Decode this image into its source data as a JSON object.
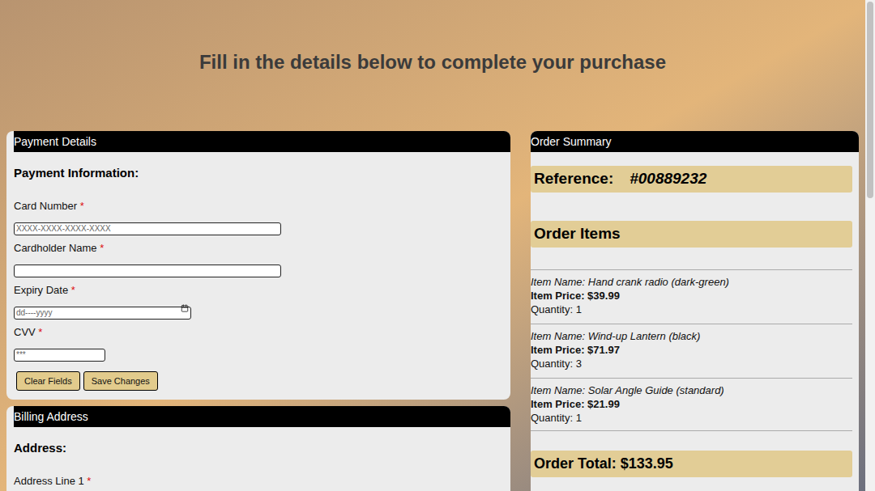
{
  "heading": "Fill in the details below to complete your purchase",
  "payment": {
    "title": "Payment Details",
    "section": "Payment Information:",
    "fields": [
      {
        "label": "Card Number",
        "required_mark": "*",
        "placeholder": "XXXX-XXXX-XXXX-XXXX",
        "kind": "text"
      },
      {
        "label": "Cardholder Name",
        "required_mark": "*",
        "placeholder": "",
        "kind": "text"
      },
      {
        "label": "Expiry Date",
        "required_mark": "*",
        "placeholder": "dd----yyyy",
        "kind": "date"
      },
      {
        "label": "CVV",
        "required_mark": "*",
        "placeholder": "***",
        "kind": "text"
      }
    ],
    "buttons": [
      "Clear Fields",
      "Save Changes"
    ]
  },
  "billing": {
    "title": "Billing Address",
    "section": "Address:",
    "fields": [
      {
        "label": "Address Line 1",
        "required_mark": "*",
        "placeholder": "",
        "kind": "text"
      }
    ]
  },
  "summary": {
    "title": "Order Summary",
    "reference_label": "Reference:",
    "reference": "#00889232",
    "items_title": "Order Items",
    "items": [
      {
        "name_label": "Item Name:",
        "name": "Hand crank radio (dark-green)",
        "price_label": "Item Price:",
        "price": "$39.99",
        "quantity_label": "Quantity:",
        "quantity": "1"
      },
      {
        "name_label": "Item Name:",
        "name": "Wind-up Lantern (black)",
        "price_label": "Item Price:",
        "price": "$71.97",
        "quantity_label": "Quantity:",
        "quantity": "3"
      },
      {
        "name_label": "Item Name:",
        "name": "Solar Angle Guide (standard)",
        "price_label": "Item Price:",
        "price": "$21.99",
        "quantity_label": "Quantity:",
        "quantity": "1"
      }
    ],
    "total": "Order Total: $133.95"
  }
}
